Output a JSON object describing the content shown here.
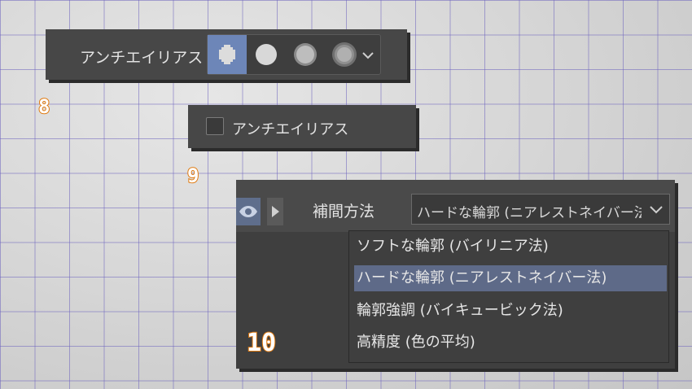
{
  "panel8": {
    "label": "アンチエイリアス",
    "options": [
      {
        "icon": "aa-none-icon",
        "selected": true
      },
      {
        "icon": "aa-weak-icon",
        "selected": false
      },
      {
        "icon": "aa-medium-icon",
        "selected": false
      },
      {
        "icon": "aa-strong-icon",
        "selected": false
      }
    ],
    "badge": "8"
  },
  "panel9": {
    "checkbox_label": "アンチエイリアス",
    "checked": false,
    "badge": "9"
  },
  "panel10": {
    "label": "補間方法",
    "selected_value": "ハードな輪郭 (ニアレストネイバー法)",
    "options": [
      "ソフトな輪郭 (バイリニア法)",
      "ハードな輪郭 (ニアレストネイバー法)",
      "輪郭強調 (バイキュービック法)",
      "高精度 (色の平均)"
    ],
    "selected_index": 1,
    "badge": "10"
  },
  "colors": {
    "panel_bg": "#474747",
    "selected_bg": "#6d86b8",
    "list_selected_bg": "#5e6a88",
    "badge_stroke": "#e07a10",
    "grid_line": "#6e64be"
  }
}
